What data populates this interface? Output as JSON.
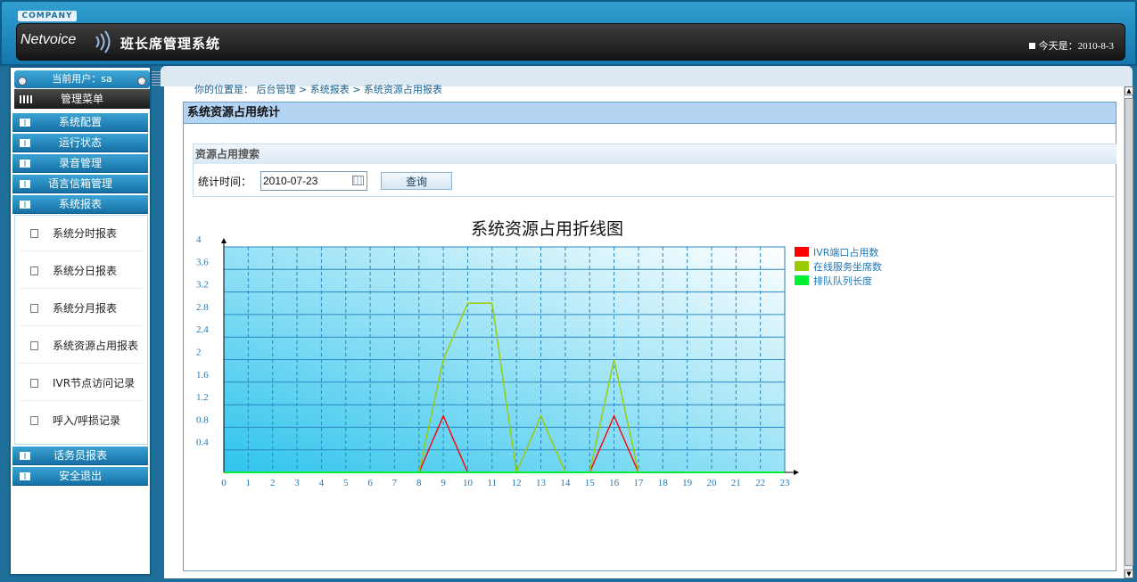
{
  "header": {
    "company": "COMPANY",
    "logo": "Netvoice",
    "app_title": "班长席管理系统",
    "today": "今天是：2010-8-3"
  },
  "sidebar": {
    "current_user": "当前用户：sa",
    "menu_title": "管理菜单",
    "items": [
      {
        "label": "系统配置"
      },
      {
        "label": "运行状态"
      },
      {
        "label": "录音管理"
      },
      {
        "label": "语言信箱管理"
      },
      {
        "label": "系统报表"
      }
    ],
    "report_items": [
      {
        "label": "系统分时报表"
      },
      {
        "label": "系统分日报表"
      },
      {
        "label": "系统分月报表"
      },
      {
        "label": "系统资源占用报表"
      },
      {
        "label": "IVR节点访问记录"
      },
      {
        "label": "呼入/呼损记录"
      }
    ],
    "bottom_items": [
      {
        "label": "话务员报表"
      },
      {
        "label": "安全退出"
      }
    ]
  },
  "main": {
    "breadcrumb": "你的位置是： 后台管理 > 系统报表 > 系统资源占用报表",
    "panel_title": "系统资源占用统计",
    "search": {
      "title": "资源占用搜索",
      "label": "统计时间：",
      "date_value": "2010-07-23",
      "button": "查询"
    }
  },
  "colors": {
    "accent": "#1a6f9c",
    "chart_bg_dark": "#2ec4ec",
    "series_ivr": "#ff0000",
    "series_online": "#99cc00",
    "series_queue": "#00ee33"
  },
  "chart_data": {
    "type": "line",
    "title": "系统资源占用折线图",
    "xlabel": "",
    "ylabel": "",
    "x": [
      0,
      1,
      2,
      3,
      4,
      5,
      6,
      7,
      8,
      9,
      10,
      11,
      12,
      13,
      14,
      15,
      16,
      17,
      18,
      19,
      20,
      21,
      22,
      23
    ],
    "yticks": [
      "0.4",
      "0.8",
      "1.2",
      "1.6",
      "2",
      "2.4",
      "2.8",
      "3.2",
      "3.6",
      "4"
    ],
    "ylim": [
      0,
      4
    ],
    "grid": true,
    "legend": "top-right",
    "series": [
      {
        "name": "IVR端口占用数",
        "color": "#ff0000",
        "values": [
          0,
          0,
          0,
          0,
          0,
          0,
          0,
          0,
          0,
          1,
          0,
          0,
          0,
          0,
          0,
          0,
          1,
          0,
          0,
          0,
          0,
          0,
          0,
          0
        ]
      },
      {
        "name": "在线服务坐席数",
        "color": "#99cc00",
        "values": [
          0,
          0,
          0,
          0,
          0,
          0,
          0,
          0,
          0,
          2,
          3,
          3,
          0,
          1,
          0,
          0,
          2,
          0,
          0,
          0,
          0,
          0,
          0,
          0
        ]
      },
      {
        "name": "排队队列长度",
        "color": "#00ee33",
        "values": [
          0,
          0,
          0,
          0,
          0,
          0,
          0,
          0,
          0,
          0,
          0,
          0,
          0,
          0,
          0,
          0,
          0,
          0,
          0,
          0,
          0,
          0,
          0,
          0
        ]
      }
    ]
  }
}
